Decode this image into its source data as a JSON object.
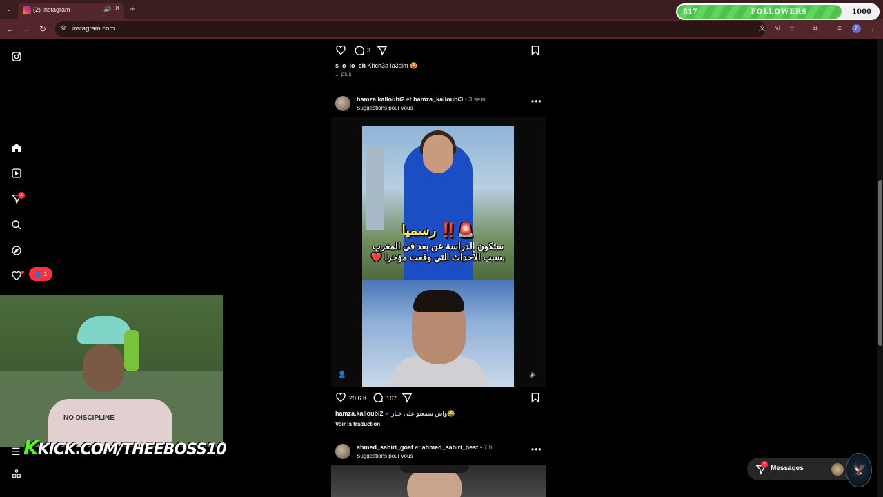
{
  "browser": {
    "tab_title": "(2) Instagram",
    "url": "instagram.com"
  },
  "followers_overlay": {
    "current": "817",
    "label": "FOLLOWERS",
    "goal": "1000",
    "progress_fraction": 0.817
  },
  "sidebar": {
    "notifications_badge": "2",
    "follow_requests_pill": "1"
  },
  "stream": {
    "watermark_k": "K",
    "watermark_text": "KICK.COM/THEEBOSS10",
    "shirt_text": "NO DISCIPLINE"
  },
  "post_prev": {
    "comments_count": "3",
    "caption_user": "s_o_lo_ch",
    "caption_text": "Khch3a la3sim 🤩",
    "more": "... plus"
  },
  "post_main": {
    "user1": "hamza.kalloubi2",
    "joiner": "et",
    "user2": "hamza_kalloubi3",
    "time": "• 3 sem",
    "suggestion": "Suggestions pour vous",
    "video_title_ar": "رسميا ‼️🚨",
    "video_sub_ar": "ستكون الدراسة عن بعد في المغرب بسبب الأحداث التي وقعت مؤخرا ❤️",
    "likes": "20,6 K",
    "comments": "167",
    "caption_user": "hamza.kalloubi2",
    "caption_text": "واش سمعتو على خبار😂",
    "translate": "Voir la traduction"
  },
  "post_next": {
    "user1": "ahmed_sabiri_goat",
    "joiner": "et",
    "user2": "ahmed_sabiri_best",
    "time": "• 7 h",
    "suggestion": "Suggestions pour vous"
  },
  "messages": {
    "label": "Messages",
    "badge": "2"
  }
}
